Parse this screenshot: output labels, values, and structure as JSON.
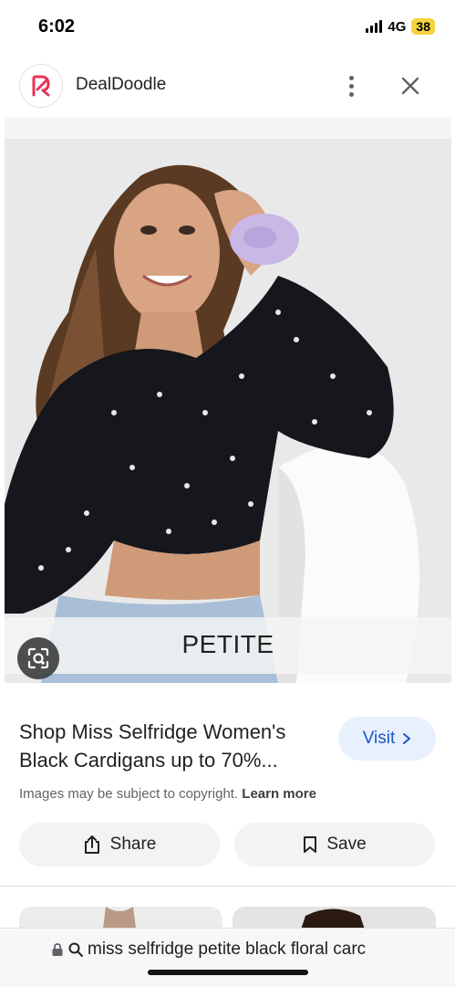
{
  "status": {
    "time": "6:02",
    "network": "4G",
    "battery": "38"
  },
  "header": {
    "app_name": "DealDoodle"
  },
  "image": {
    "overlay_label": "PETITE"
  },
  "product": {
    "title": "Shop Miss Selfridge Women's Black Cardigans up to 70%...",
    "visit_label": "Visit"
  },
  "notice": {
    "text": "Images may be subject to copyright.",
    "link": "Learn more"
  },
  "actions": {
    "share_label": "Share",
    "save_label": "Save"
  },
  "url_bar": {
    "text": "miss selfridge petite black floral carc"
  },
  "colors": {
    "brand": "#e8335a",
    "visit_bg": "#e8f0fe",
    "visit_text": "#1a56c4",
    "battery": "#f6d33c"
  },
  "icons": [
    "signal-icon",
    "brand-logo-icon",
    "more-vert-icon",
    "close-icon",
    "lens-icon",
    "chevron-right-icon",
    "share-icon",
    "bookmark-icon",
    "lock-icon",
    "search-icon"
  ]
}
